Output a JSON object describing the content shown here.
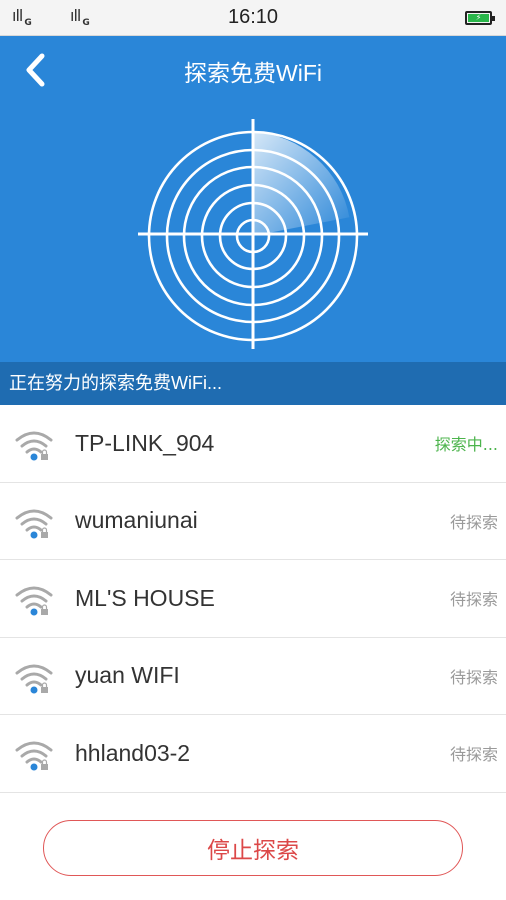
{
  "status_bar": {
    "signal1": "ıll",
    "sim1": "G",
    "signal2": "ıll",
    "sim2": "G",
    "time": "16:10",
    "battery_icon": "battery-charging-icon"
  },
  "header": {
    "title": "探索免费WiFi",
    "back_icon": "chevron-left-icon",
    "radar_icon": "radar-icon"
  },
  "progress_text": "正在努力的探索免费WiFi...",
  "networks": [
    {
      "ssid": "TP-LINK_904",
      "status": "探索中...",
      "active": true
    },
    {
      "ssid": "wumaniunai",
      "status": "待探索",
      "active": false
    },
    {
      "ssid": "ML'S HOUSE",
      "status": "待探索",
      "active": false
    },
    {
      "ssid": "yuan WIFI",
      "status": "待探索",
      "active": false
    },
    {
      "ssid": "hhland03-2",
      "status": "待探索",
      "active": false
    }
  ],
  "stop_button_label": "停止探索",
  "colors": {
    "header_bg": "#2a86d8",
    "progress_bg": "#1f6cb1",
    "active_status": "#4cb44c",
    "stop_button": "#dc4848"
  }
}
